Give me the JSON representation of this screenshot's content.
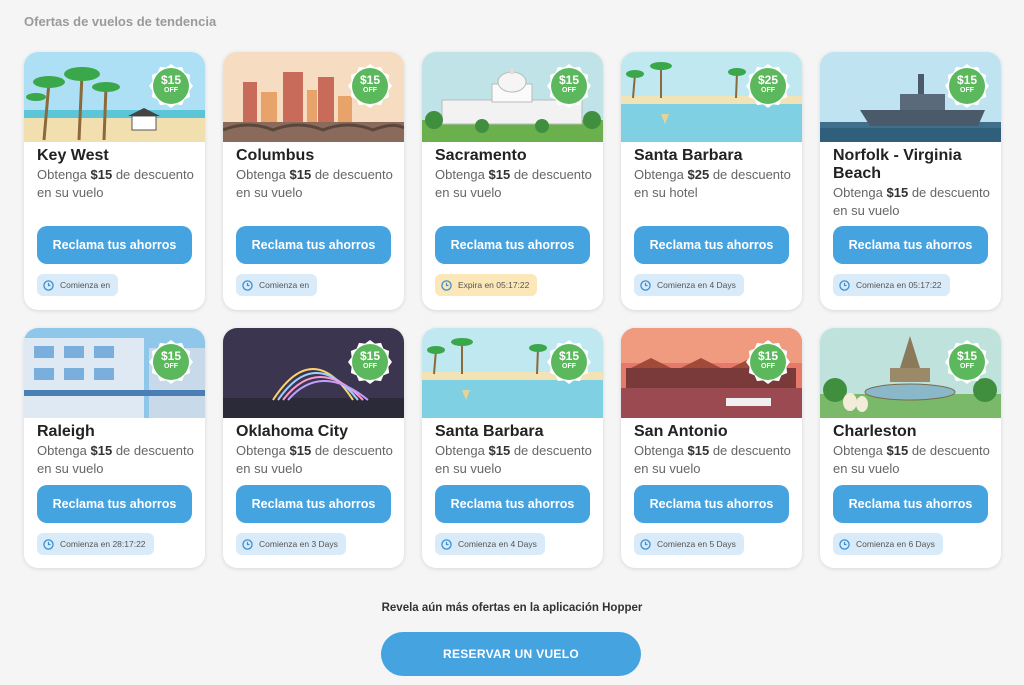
{
  "section_title": "Ofertas de vuelos de tendencia",
  "cards": [
    {
      "city": "Key West",
      "desc_pre": "Obtenga ",
      "amount": "$15",
      "desc_post": " de descuento en su vuelo",
      "badge_amount": "$15",
      "badge_off": "OFF",
      "cta": "Reclama tus ahorros",
      "timer": "Comienza en",
      "timer_type": "start",
      "scene": "beach"
    },
    {
      "city": "Columbus",
      "desc_pre": "Obtenga ",
      "amount": "$15",
      "desc_post": " de descuento en su vuelo",
      "badge_amount": "$15",
      "badge_off": "OFF",
      "cta": "Reclama tus ahorros",
      "timer": "Comienza en",
      "timer_type": "start",
      "scene": "city"
    },
    {
      "city": "Sacramento",
      "desc_pre": "Obtenga ",
      "amount": "$15",
      "desc_post": " de descuento en su vuelo",
      "badge_amount": "$15",
      "badge_off": "OFF",
      "cta": "Reclama tus ahorros",
      "timer": "Expira en 05:17:22",
      "timer_type": "expire",
      "scene": "capitol"
    },
    {
      "city": "Santa Barbara",
      "desc_pre": "Obtenga ",
      "amount": "$25",
      "desc_post": " de descuento en su hotel",
      "badge_amount": "$25",
      "badge_off": "OFF",
      "cta": "Reclama tus ahorros",
      "timer": "Comienza en 4 Days",
      "timer_type": "start",
      "scene": "coast"
    },
    {
      "city": "Norfolk - Virginia Beach",
      "desc_pre": "Obtenga ",
      "amount": "$15",
      "desc_post": " de descuento en su vuelo",
      "badge_amount": "$15",
      "badge_off": "OFF",
      "cta": "Reclama tus ahorros",
      "timer": "Comienza en 05:17:22",
      "timer_type": "start",
      "scene": "ship"
    },
    {
      "city": "Raleigh",
      "desc_pre": "Obtenga ",
      "amount": "$15",
      "desc_post": " de descuento en su vuelo",
      "badge_amount": "$15",
      "badge_off": "OFF",
      "cta": "Reclama tus ahorros",
      "timer": "Comienza en 28:17:22",
      "timer_type": "start",
      "scene": "building"
    },
    {
      "city": "Oklahoma City",
      "desc_pre": "Obtenga ",
      "amount": "$15",
      "desc_post": " de descuento en su vuelo",
      "badge_amount": "$15",
      "badge_off": "OFF",
      "cta": "Reclama tus ahorros",
      "timer": "Comienza en 3 Days",
      "timer_type": "start",
      "scene": "arch"
    },
    {
      "city": "Santa Barbara",
      "desc_pre": "Obtenga ",
      "amount": "$15",
      "desc_post": " de descuento en su vuelo",
      "badge_amount": "$15",
      "badge_off": "OFF",
      "cta": "Reclama tus ahorros",
      "timer": "Comienza en 4 Days",
      "timer_type": "start",
      "scene": "coast"
    },
    {
      "city": "San Antonio",
      "desc_pre": "Obtenga ",
      "amount": "$15",
      "desc_post": " de descuento en su vuelo",
      "badge_amount": "$15",
      "badge_off": "OFF",
      "cta": "Reclama tus ahorros",
      "timer": "Comienza en 5 Days",
      "timer_type": "start",
      "scene": "river"
    },
    {
      "city": "Charleston",
      "desc_pre": "Obtenga ",
      "amount": "$15",
      "desc_post": " de descuento en su vuelo",
      "badge_amount": "$15",
      "badge_off": "OFF",
      "cta": "Reclama tus ahorros",
      "timer": "Comienza en 6 Days",
      "timer_type": "start",
      "scene": "fountain"
    }
  ],
  "footer": {
    "text": "Revela aún más ofertas en la aplicación Hopper",
    "button": "RESERVAR UN VUELO"
  },
  "colors": {
    "accent": "#45a3e0",
    "badge_green": "#5cb85c",
    "timer_blue": "#d9ebf8",
    "timer_yellow": "#fbe7b8"
  },
  "icons": {
    "timer": "clock-icon"
  }
}
